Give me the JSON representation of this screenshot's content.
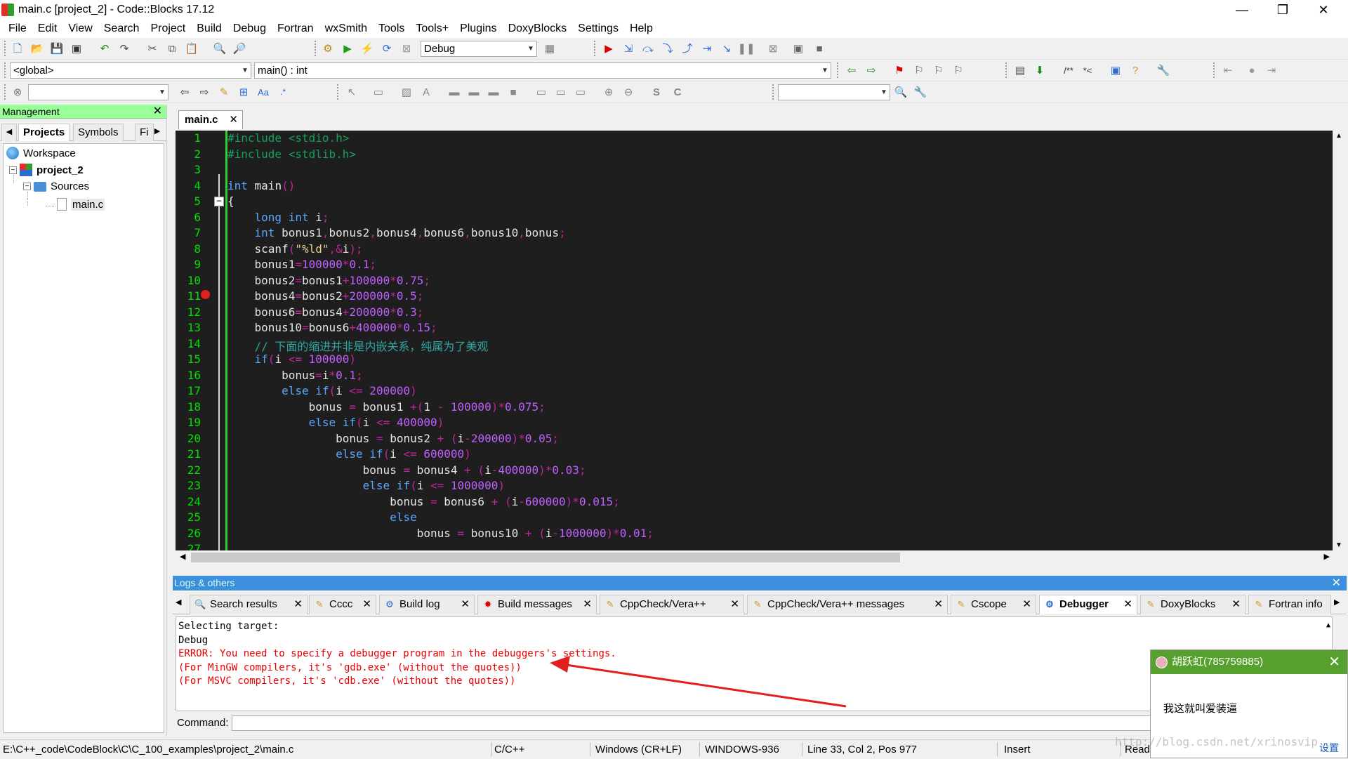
{
  "window": {
    "title": "main.c [project_2] - Code::Blocks 17.12",
    "minimize": "—",
    "maximize": "❐",
    "close": "✕"
  },
  "menu": [
    "File",
    "Edit",
    "View",
    "Search",
    "Project",
    "Build",
    "Debug",
    "Fortran",
    "wxSmith",
    "Tools",
    "Tools+",
    "Plugins",
    "DoxyBlocks",
    "Settings",
    "Help"
  ],
  "toolbar": {
    "build_target": "Debug",
    "scope": "<global>",
    "function": "main() : int",
    "search_placeholder": ""
  },
  "management": {
    "title": "Management",
    "tabs": [
      "Projects",
      "Symbols",
      "Fi"
    ],
    "tree": {
      "workspace": "Workspace",
      "project": "project_2",
      "folder": "Sources",
      "file": "main.c"
    }
  },
  "editor": {
    "tab": "main.c",
    "lines": [
      {
        "n": "1",
        "t": [
          [
            "pp",
            "#include <stdio.h>"
          ]
        ]
      },
      {
        "n": "2",
        "t": [
          [
            "pp",
            "#include <stdlib.h>"
          ]
        ]
      },
      {
        "n": "3",
        "t": []
      },
      {
        "n": "4",
        "t": [
          [
            "kw",
            "int"
          ],
          [
            "id",
            " main"
          ],
          [
            "op",
            "()"
          ]
        ]
      },
      {
        "n": "5",
        "t": [
          [
            "id",
            "{"
          ]
        ]
      },
      {
        "n": "6",
        "t": [
          [
            "id",
            "    "
          ],
          [
            "kw",
            "long int"
          ],
          [
            "id",
            " i"
          ],
          [
            "op",
            ";"
          ]
        ]
      },
      {
        "n": "7",
        "t": [
          [
            "id",
            "    "
          ],
          [
            "kw",
            "int"
          ],
          [
            "id",
            " bonus1"
          ],
          [
            "op",
            ","
          ],
          [
            "id",
            "bonus2"
          ],
          [
            "op",
            ","
          ],
          [
            "id",
            "bonus4"
          ],
          [
            "op",
            ","
          ],
          [
            "id",
            "bonus6"
          ],
          [
            "op",
            ","
          ],
          [
            "id",
            "bonus10"
          ],
          [
            "op",
            ","
          ],
          [
            "id",
            "bonus"
          ],
          [
            "op",
            ";"
          ]
        ]
      },
      {
        "n": "8",
        "t": [
          [
            "id",
            "    scanf"
          ],
          [
            "op",
            "("
          ],
          [
            "str",
            "\"%ld\""
          ],
          [
            "op",
            ",&"
          ],
          [
            "id",
            "i"
          ],
          [
            "op",
            ");"
          ]
        ]
      },
      {
        "n": "9",
        "t": [
          [
            "id",
            "    bonus1"
          ],
          [
            "op",
            "="
          ],
          [
            "num",
            "100000"
          ],
          [
            "op",
            "*"
          ],
          [
            "num",
            "0.1"
          ],
          [
            "op",
            ";"
          ]
        ]
      },
      {
        "n": "10",
        "t": [
          [
            "id",
            "    bonus2"
          ],
          [
            "op",
            "="
          ],
          [
            "id",
            "bonus1"
          ],
          [
            "op",
            "+"
          ],
          [
            "num",
            "100000"
          ],
          [
            "op",
            "*"
          ],
          [
            "num",
            "0.75"
          ],
          [
            "op",
            ";"
          ]
        ]
      },
      {
        "n": "11",
        "t": [
          [
            "id",
            "    bonus4"
          ],
          [
            "op",
            "="
          ],
          [
            "id",
            "bonus2"
          ],
          [
            "op",
            "+"
          ],
          [
            "num",
            "200000"
          ],
          [
            "op",
            "*"
          ],
          [
            "num",
            "0.5"
          ],
          [
            "op",
            ";"
          ]
        ]
      },
      {
        "n": "12",
        "t": [
          [
            "id",
            "    bonus6"
          ],
          [
            "op",
            "="
          ],
          [
            "id",
            "bonus4"
          ],
          [
            "op",
            "+"
          ],
          [
            "num",
            "200000"
          ],
          [
            "op",
            "*"
          ],
          [
            "num",
            "0.3"
          ],
          [
            "op",
            ";"
          ]
        ]
      },
      {
        "n": "13",
        "t": [
          [
            "id",
            "    bonus10"
          ],
          [
            "op",
            "="
          ],
          [
            "id",
            "bonus6"
          ],
          [
            "op",
            "+"
          ],
          [
            "num",
            "400000"
          ],
          [
            "op",
            "*"
          ],
          [
            "num",
            "0.15"
          ],
          [
            "op",
            ";"
          ]
        ]
      },
      {
        "n": "14",
        "t": [
          [
            "cm",
            "    // 下面的缩进并非是内嵌关系，纯属为了美观"
          ]
        ]
      },
      {
        "n": "15",
        "t": [
          [
            "id",
            "    "
          ],
          [
            "kw",
            "if"
          ],
          [
            "op",
            "("
          ],
          [
            "id",
            "i "
          ],
          [
            "op",
            "<="
          ],
          [
            "num",
            " 100000"
          ],
          [
            "op",
            ")"
          ]
        ]
      },
      {
        "n": "16",
        "t": [
          [
            "id",
            "        bonus"
          ],
          [
            "op",
            "="
          ],
          [
            "id",
            "i"
          ],
          [
            "op",
            "*"
          ],
          [
            "num",
            "0.1"
          ],
          [
            "op",
            ";"
          ]
        ]
      },
      {
        "n": "17",
        "t": [
          [
            "id",
            "        "
          ],
          [
            "kw",
            "else if"
          ],
          [
            "op",
            "("
          ],
          [
            "id",
            "i "
          ],
          [
            "op",
            "<="
          ],
          [
            "num",
            " 200000"
          ],
          [
            "op",
            ")"
          ]
        ]
      },
      {
        "n": "18",
        "t": [
          [
            "id",
            "            bonus "
          ],
          [
            "op",
            "="
          ],
          [
            "id",
            " bonus1 "
          ],
          [
            "op",
            "+("
          ],
          [
            "id",
            "1 "
          ],
          [
            "op",
            "-"
          ],
          [
            "num",
            " 100000"
          ],
          [
            "op",
            ")*"
          ],
          [
            "num",
            "0.075"
          ],
          [
            "op",
            ";"
          ]
        ]
      },
      {
        "n": "19",
        "t": [
          [
            "id",
            "            "
          ],
          [
            "kw",
            "else if"
          ],
          [
            "op",
            "("
          ],
          [
            "id",
            "i "
          ],
          [
            "op",
            "<="
          ],
          [
            "num",
            " 400000"
          ],
          [
            "op",
            ")"
          ]
        ]
      },
      {
        "n": "20",
        "t": [
          [
            "id",
            "                bonus "
          ],
          [
            "op",
            "="
          ],
          [
            "id",
            " bonus2 "
          ],
          [
            "op",
            "+ ("
          ],
          [
            "id",
            "i"
          ],
          [
            "op",
            "-"
          ],
          [
            "num",
            "200000"
          ],
          [
            "op",
            ")*"
          ],
          [
            "num",
            "0.05"
          ],
          [
            "op",
            ";"
          ]
        ]
      },
      {
        "n": "21",
        "t": [
          [
            "id",
            "                "
          ],
          [
            "kw",
            "else if"
          ],
          [
            "op",
            "("
          ],
          [
            "id",
            "i "
          ],
          [
            "op",
            "<="
          ],
          [
            "num",
            " 600000"
          ],
          [
            "op",
            ")"
          ]
        ]
      },
      {
        "n": "22",
        "t": [
          [
            "id",
            "                    bonus "
          ],
          [
            "op",
            "="
          ],
          [
            "id",
            " bonus4 "
          ],
          [
            "op",
            "+ ("
          ],
          [
            "id",
            "i"
          ],
          [
            "op",
            "-"
          ],
          [
            "num",
            "400000"
          ],
          [
            "op",
            ")*"
          ],
          [
            "num",
            "0.03"
          ],
          [
            "op",
            ";"
          ]
        ]
      },
      {
        "n": "23",
        "t": [
          [
            "id",
            "                    "
          ],
          [
            "kw",
            "else if"
          ],
          [
            "op",
            "("
          ],
          [
            "id",
            "i "
          ],
          [
            "op",
            "<="
          ],
          [
            "num",
            " 1000000"
          ],
          [
            "op",
            ")"
          ]
        ]
      },
      {
        "n": "24",
        "t": [
          [
            "id",
            "                        bonus "
          ],
          [
            "op",
            "="
          ],
          [
            "id",
            " bonus6 "
          ],
          [
            "op",
            "+ ("
          ],
          [
            "id",
            "i"
          ],
          [
            "op",
            "-"
          ],
          [
            "num",
            "600000"
          ],
          [
            "op",
            ")*"
          ],
          [
            "num",
            "0.015"
          ],
          [
            "op",
            ";"
          ]
        ]
      },
      {
        "n": "25",
        "t": [
          [
            "id",
            "                        "
          ],
          [
            "kw",
            "else"
          ]
        ]
      },
      {
        "n": "26",
        "t": [
          [
            "id",
            "                            bonus "
          ],
          [
            "op",
            "="
          ],
          [
            "id",
            " bonus10 "
          ],
          [
            "op",
            "+ ("
          ],
          [
            "id",
            "i"
          ],
          [
            "op",
            "-"
          ],
          [
            "num",
            "1000000"
          ],
          [
            "op",
            ")*"
          ],
          [
            "num",
            "0.01"
          ],
          [
            "op",
            ";"
          ]
        ]
      },
      {
        "n": "27",
        "t": []
      }
    ]
  },
  "logs": {
    "title": "Logs & others",
    "tabs": [
      "Search results",
      "Cccc",
      "Build log",
      "Build messages",
      "CppCheck/Vera++",
      "CppCheck/Vera++ messages",
      "Cscope",
      "Debugger",
      "DoxyBlocks",
      "Fortran info"
    ],
    "active_tab": "Debugger",
    "output": [
      {
        "text": "Selecting target:",
        "error": false
      },
      {
        "text": "Debug",
        "error": false
      },
      {
        "text": "ERROR: You need to specify a debugger program in the debuggers's settings.",
        "error": true
      },
      {
        "text": "(For MinGW compilers, it's 'gdb.exe' (without the quotes))",
        "error": true
      },
      {
        "text": "(For MSVC compilers, it's 'cdb.exe' (without the quotes))",
        "error": true
      }
    ],
    "command_label": "Command:"
  },
  "status": {
    "path": "E:\\C++_code\\CodeBlock\\C\\C_100_examples\\project_2\\main.c",
    "lang": "C/C++",
    "eol": "Windows (CR+LF)",
    "encoding": "WINDOWS-936",
    "position": "Line 33, Col 2, Pos 977",
    "mode": "Insert",
    "rw": "Read"
  },
  "popup": {
    "sender": "胡跃虹(785759885)",
    "message": "我这就叫爱装逼",
    "settings": "设置"
  },
  "watermark": "http://blog.csdn.net/xrinosvip",
  "colors": {
    "accent_green": "#99ff99",
    "logs_header": "#3e8ede",
    "error": "#e80000",
    "popup_green": "#56a02e"
  }
}
